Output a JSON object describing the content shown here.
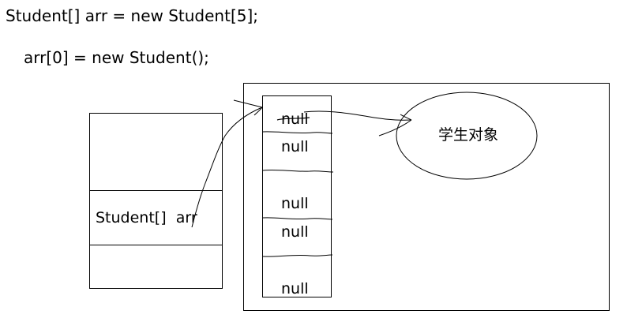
{
  "code": {
    "line1": "Student[] arr = new Student[5];",
    "line2": "arr[0] = new Student();"
  },
  "stack": {
    "var_label": "Student[]  arr"
  },
  "array": {
    "cells": [
      "null",
      "null",
      "null",
      "null",
      "null"
    ]
  },
  "object": {
    "label": "学生对象"
  }
}
